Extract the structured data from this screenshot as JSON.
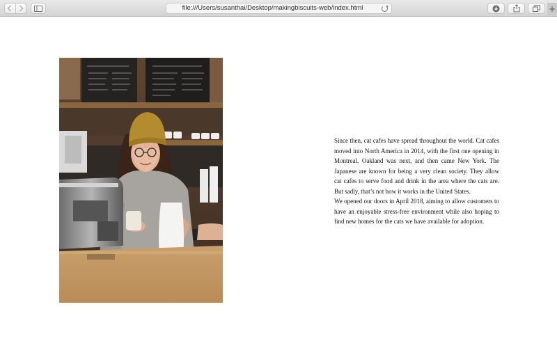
{
  "browser": {
    "url": "file:///Users/susanthai/Desktop/makingbiscuits-web/index.html",
    "icons": {
      "back": "chevron-left-icon",
      "forward": "chevron-right-icon",
      "sidebar": "sidebar-icon",
      "reload": "reload-icon",
      "download": "download-icon",
      "share": "share-icon",
      "tabs": "tabs-icon",
      "new_tab": "plus-icon"
    }
  },
  "content": {
    "photo_icon": "barista-photo",
    "paragraphs": [
      "Since then, cat cafes have spread throughout the world. Cat cafes moved into North America in 2014, with the first one opening in Montreal. Oakland was next, and then came New York. The Japanese are known for being a very clean society. They allow cat cafes to serve food and drink in the area where the cats are. But sadly, that’s not how it works in the United States.",
      "We opened our doors in April 2018, aiming to allow customers to have an enjoyable stress-free environment while also hoping to find new homes for the cats we have available for adoption."
    ]
  }
}
